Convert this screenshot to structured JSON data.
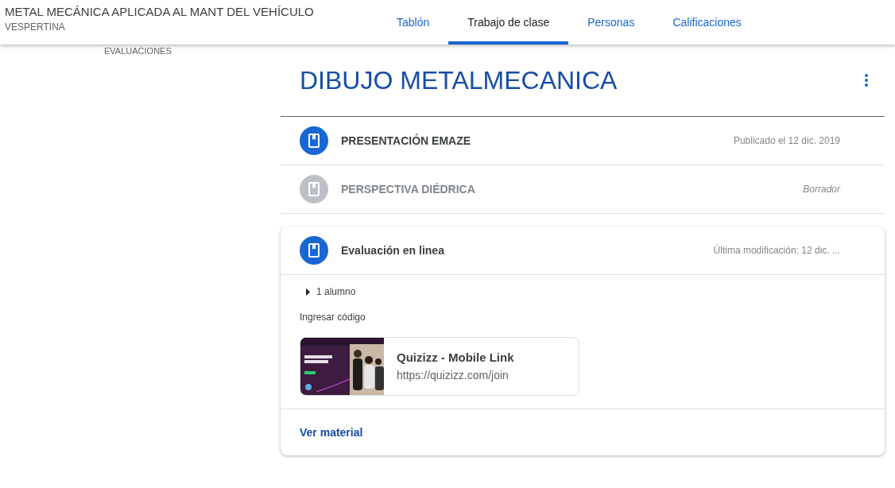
{
  "header": {
    "class_title": "METAL MECÁNICA APLICADA AL MANT DEL VEHÍCULO",
    "section": "VESPERTINA"
  },
  "tabs": [
    {
      "label": "Tablón",
      "selected": false
    },
    {
      "label": "Trabajo de clase",
      "selected": true
    },
    {
      "label": "Personas",
      "selected": false
    },
    {
      "label": "Calificaciones",
      "selected": false
    }
  ],
  "sidebar": {
    "topic_link": "EVALUACIONES"
  },
  "topic": {
    "title": "DIBUJO METALMECANICA"
  },
  "materials": [
    {
      "title": "PRESENTACIÓN EMAZE",
      "status": "Publicado el 12 dic. 2019",
      "draft": false,
      "expanded": false
    },
    {
      "title": "PERSPECTIVA DIÉDRICA",
      "status": "Borrador",
      "draft": true,
      "expanded": false
    },
    {
      "title": "Evaluación en linea",
      "status": "Última modificación: 12 dic. ...",
      "draft": false,
      "expanded": true,
      "students": "1 alumno",
      "description": "Ingresar código",
      "attachment": {
        "kind": "picture",
        "title": "Quizizz - Mobile Link",
        "url": "https://quizizz.com/join"
      },
      "action": "Ver material"
    }
  ]
}
